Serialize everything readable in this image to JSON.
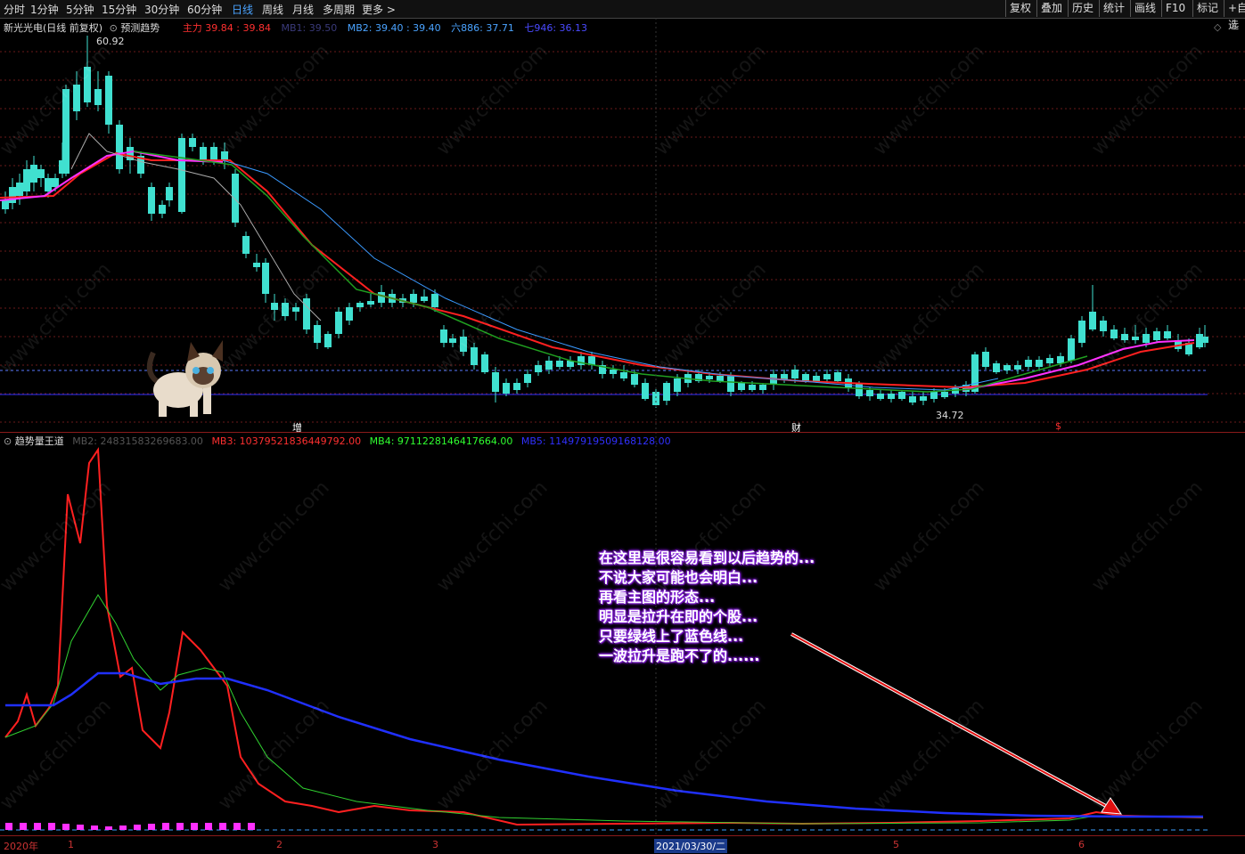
{
  "topbar": {
    "periods": [
      "分时",
      "1分钟",
      "5分钟",
      "15分钟",
      "30分钟",
      "60分钟",
      "日线",
      "周线",
      "月线",
      "多周期",
      "更多 >"
    ],
    "active_period": "日线",
    "right_buttons": [
      "复权",
      "叠加",
      "历史",
      "统计",
      "画线",
      "F10",
      "标记",
      "+自选"
    ]
  },
  "main_legend": {
    "stock": "新光光电(日线 前复权)",
    "indicator": "预测趋势",
    "items": [
      {
        "label": "主力 39.84 : 39.84",
        "color": "#ff3030"
      },
      {
        "label": "MB1: 39.50",
        "color": "#3a3a7a"
      },
      {
        "label": "MB2: 39.40 : 39.40",
        "color": "#4aa3ff"
      },
      {
        "label": "六886: 37.71",
        "color": "#4aa3ff"
      },
      {
        "label": "七946: 36.13",
        "color": "#4a4aff"
      }
    ]
  },
  "price_labels": {
    "high": "60.92",
    "low": "34.72"
  },
  "markers": [
    {
      "text": "增",
      "color": "#ffffff"
    },
    {
      "text": "财",
      "color": "#ffffff"
    },
    {
      "text": "$",
      "color": "#ff3030"
    }
  ],
  "sub_legend": {
    "indicator": "趋势量王道",
    "items": [
      {
        "label": "MB2: 24831583269683.00",
        "color": "#555555"
      },
      {
        "label": "MB3: 10379521836449792.00",
        "color": "#ff3030"
      },
      {
        "label": "MB4: 9711228146417664.00",
        "color": "#30ff30"
      },
      {
        "label": "MB5: 11497919509168128.00",
        "color": "#3030ff"
      }
    ]
  },
  "annotation": [
    "在这里是很容易看到以后趋势的...",
    "不说大家可能也会明白...",
    "再看主图的形态...",
    "明显是拉升在即的个股...",
    "只要绿线上了蓝色线...",
    "一波拉升是跑不了的......"
  ],
  "xaxis": [
    "2020年",
    "1",
    "2",
    "3",
    "2021/03/30/二",
    "5",
    "6"
  ],
  "watermark": "www.cfchi.com",
  "chart_data": {
    "type": "line",
    "title": "新光光电(日线 前复权)",
    "price_high": 60.92,
    "price_low": 34.72,
    "series": [
      {
        "name": "主力",
        "values": [
          39.84
        ]
      },
      {
        "name": "MB1",
        "values": [
          39.5
        ]
      },
      {
        "name": "MB2",
        "values": [
          39.4
        ]
      },
      {
        "name": "六886",
        "values": [
          37.71
        ]
      },
      {
        "name": "七946",
        "values": [
          36.13
        ]
      }
    ]
  }
}
